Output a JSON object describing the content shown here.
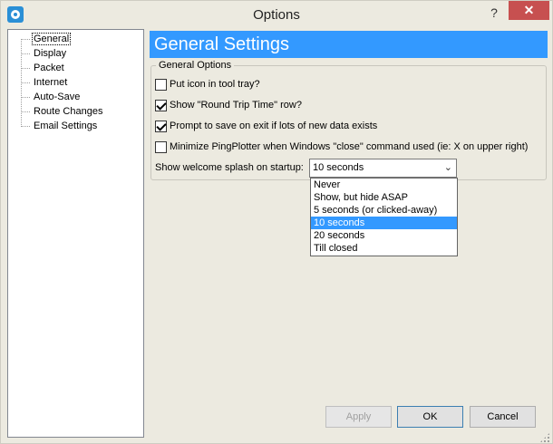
{
  "window": {
    "title": "Options",
    "help_label": "?",
    "close_label": "✕"
  },
  "nav": {
    "items": [
      {
        "label": "General",
        "selected": true
      },
      {
        "label": "Display"
      },
      {
        "label": "Packet"
      },
      {
        "label": "Internet"
      },
      {
        "label": "Auto-Save"
      },
      {
        "label": "Route Changes"
      },
      {
        "label": "Email Settings"
      }
    ]
  },
  "main": {
    "header": "General Settings",
    "group_title": "General Options",
    "checkboxes": [
      {
        "label": "Put icon in tool tray?",
        "checked": false
      },
      {
        "label": "Show \"Round Trip Time\" row?",
        "checked": true
      },
      {
        "label": "Prompt to save on exit if lots of new data exists",
        "checked": true
      },
      {
        "label": "Minimize PingPlotter when Windows \"close\" command used (ie: X on upper right)",
        "checked": false
      }
    ],
    "splash_label": "Show welcome splash on startup:",
    "splash_select": {
      "value": "10 seconds",
      "options": [
        "Never",
        "Show, but hide ASAP",
        "5 seconds (or clicked-away)",
        "10 seconds",
        "20 seconds",
        "Till closed"
      ]
    }
  },
  "buttons": {
    "apply": "Apply",
    "ok": "OK",
    "cancel": "Cancel"
  },
  "icons": {
    "app": "pingplotter-app-icon",
    "close": "close-icon",
    "dropdown": "chevron-down-icon"
  },
  "colors": {
    "accent": "#3399ff",
    "close_button": "#c75050"
  }
}
